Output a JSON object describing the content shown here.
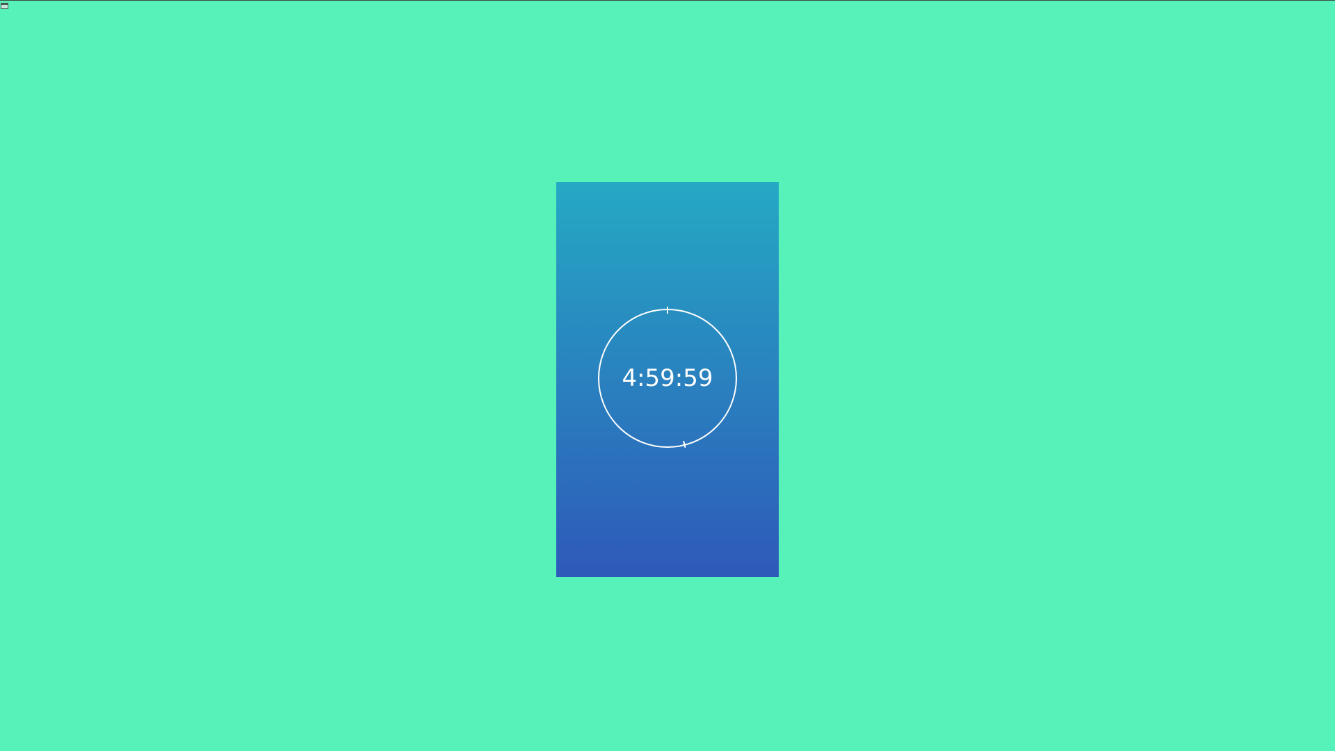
{
  "window": {
    "icon": "window-icon"
  },
  "colors": {
    "background": "#57f2b9",
    "card_gradient_top": "#25a9c4",
    "card_gradient_bottom": "#2e59b9",
    "ring": "#ffffff",
    "text": "#ffffff"
  },
  "timer": {
    "display": "4:59:59",
    "progress": 0.94
  }
}
